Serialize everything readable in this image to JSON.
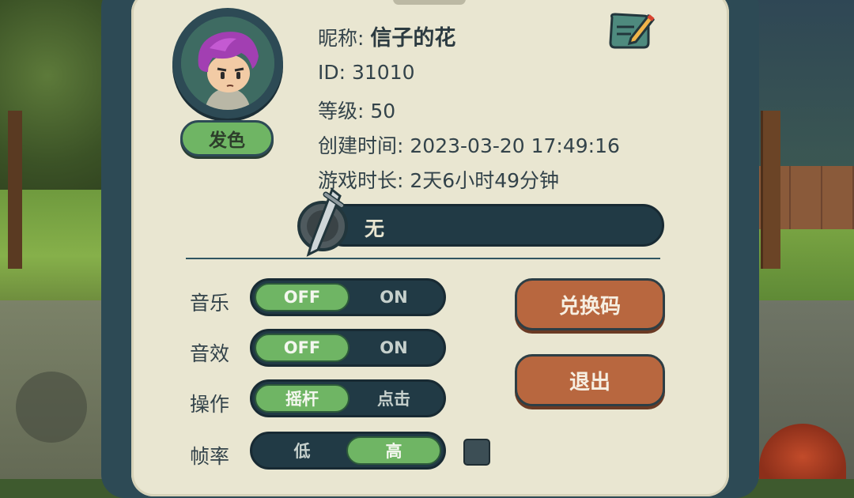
{
  "profile": {
    "nickname_label": "昵称:",
    "nickname": "信子的花",
    "id_label": "ID:",
    "id": "31010",
    "level_label": "等级:",
    "level": "50",
    "created_label": "创建时间:",
    "created": "2023-03-20 17:49:16",
    "playtime_label": "游戏时长:",
    "playtime": "2天6小时49分钟",
    "hair_color_button": "发色",
    "title_value": "无"
  },
  "settings": {
    "music_label": "音乐",
    "music_off": "OFF",
    "music_on": "ON",
    "music_selected": "OFF",
    "sfx_label": "音效",
    "sfx_off": "OFF",
    "sfx_on": "ON",
    "sfx_selected": "OFF",
    "control_label": "操作",
    "control_joystick": "摇杆",
    "control_tap": "点击",
    "control_selected": "摇杆",
    "framerate_label": "帧率",
    "framerate_low": "低",
    "framerate_high": "高",
    "framerate_selected": "高"
  },
  "buttons": {
    "redeem_code": "兑换码",
    "logout": "退出"
  },
  "icons": {
    "edit": "edit-note-icon",
    "title_badge": "sword-shield-icon",
    "avatar": "avatar-portrait-icon"
  },
  "colors": {
    "panel_bg": "#e9e6d1",
    "frame": "#2d4a55",
    "toggle_on": "#6fb564",
    "orange_button": "#b8673f"
  }
}
